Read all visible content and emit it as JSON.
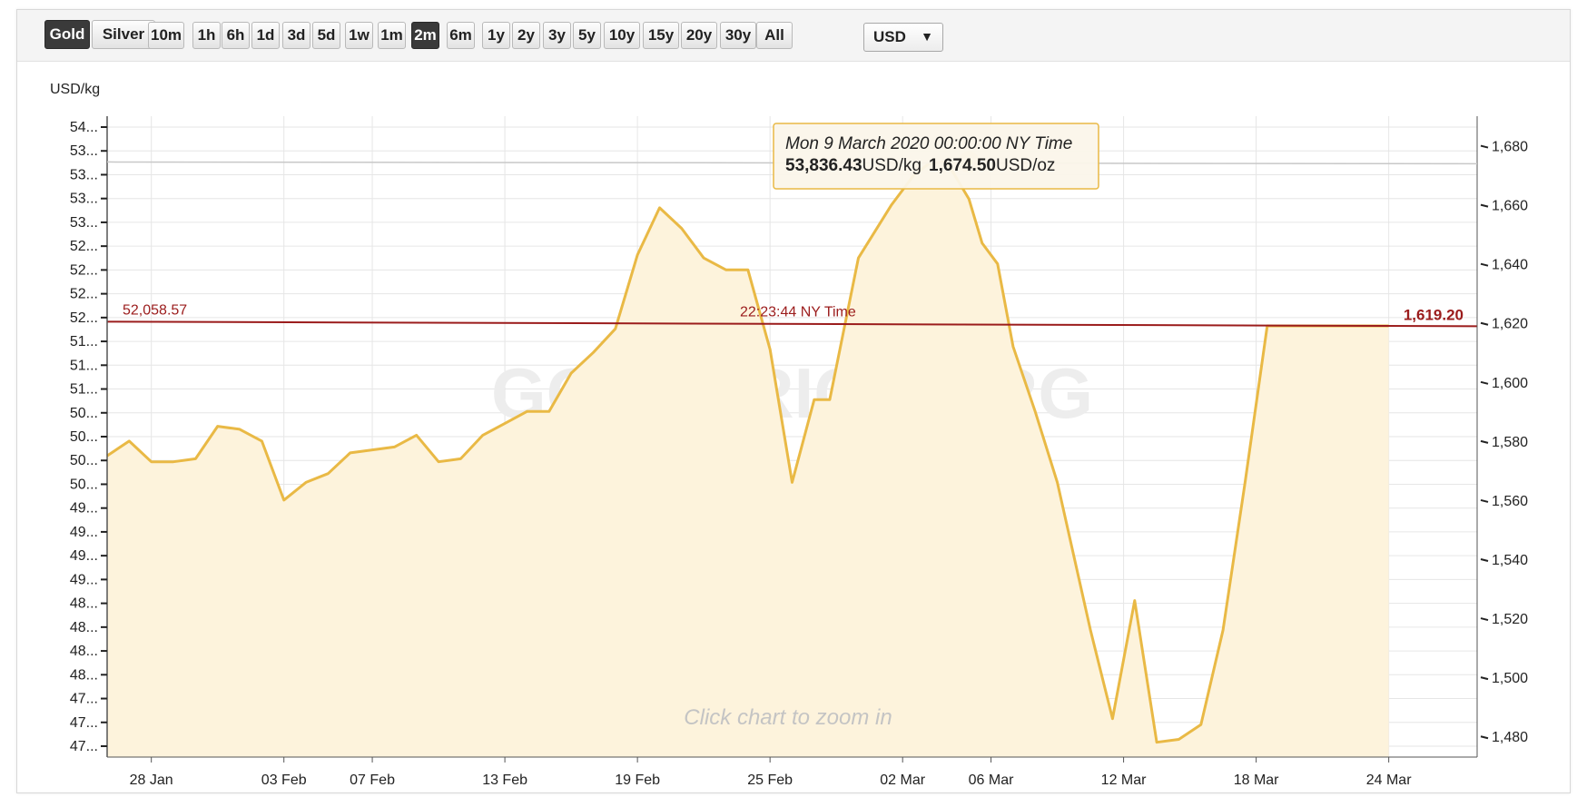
{
  "toolbar": {
    "metals": [
      {
        "label": "Gold",
        "active": true
      },
      {
        "label": "Silver",
        "active": false
      }
    ],
    "ranges": [
      {
        "label": "10m",
        "active": false
      },
      {
        "label": "1h",
        "active": false
      },
      {
        "label": "6h",
        "active": false
      },
      {
        "label": "1d",
        "active": false
      },
      {
        "label": "3d",
        "active": false
      },
      {
        "label": "5d",
        "active": false
      },
      {
        "label": "1w",
        "active": false
      },
      {
        "label": "1m",
        "active": false
      },
      {
        "label": "2m",
        "active": true
      },
      {
        "label": "6m",
        "active": false
      },
      {
        "label": "1y",
        "active": false
      },
      {
        "label": "2y",
        "active": false
      },
      {
        "label": "3y",
        "active": false
      },
      {
        "label": "5y",
        "active": false
      },
      {
        "label": "10y",
        "active": false
      },
      {
        "label": "15y",
        "active": false
      },
      {
        "label": "20y",
        "active": false
      },
      {
        "label": "30y",
        "active": false
      },
      {
        "label": "All",
        "active": false
      }
    ],
    "currency": {
      "value": "USD",
      "caret": "▼"
    }
  },
  "colors": {
    "line": "#e9b945",
    "area": "#fdf3dc",
    "reference": "#9b1c1c",
    "grid": "#e6e6e6",
    "axis": "#555555"
  },
  "chart_data": {
    "type": "area",
    "ylabel_left": "USD/kg",
    "left_ticks": [
      "47...",
      "47...",
      "47...",
      "48...",
      "48...",
      "48...",
      "48...",
      "49...",
      "49...",
      "49...",
      "49...",
      "50...",
      "50...",
      "50...",
      "50...",
      "51...",
      "51...",
      "51...",
      "52...",
      "52...",
      "52...",
      "52...",
      "53...",
      "53...",
      "53...",
      "53...",
      "54..."
    ],
    "right_ticks": [
      1480,
      1500,
      1520,
      1540,
      1560,
      1580,
      1600,
      1620,
      1640,
      1660,
      1680
    ],
    "right_ylim": [
      1473,
      1690
    ],
    "x_ticks": [
      "28 Jan",
      "03 Feb",
      "07 Feb",
      "13 Feb",
      "19 Feb",
      "25 Feb",
      "02 Mar",
      "06 Mar",
      "12 Mar",
      "18 Mar",
      "24 Mar"
    ],
    "x_tick_days": [
      2,
      8,
      12,
      18,
      24,
      30,
      36,
      40,
      46,
      52,
      58
    ],
    "x_range_days": [
      0,
      62
    ],
    "series": [
      {
        "unit": "USD/oz",
        "x_days": [
          0,
          1.0,
          2.0,
          3.0,
          4.0,
          5.0,
          6.0,
          7.0,
          8.0,
          9.0,
          10.0,
          11.0,
          12.0,
          13.0,
          14.0,
          15.0,
          16.0,
          17.0,
          18.0,
          19.0,
          20.0,
          21.0,
          22.0,
          23.0,
          24.0,
          25.0,
          26.0,
          27.0,
          28.0,
          29.0,
          30.0,
          31.0,
          32.0,
          32.7,
          34.0,
          35.5,
          36.5,
          37.2,
          38.0,
          39.0,
          39.6,
          40.3,
          41.0,
          42.0,
          43.0,
          44.5,
          45.5,
          46.5,
          47.5,
          48.5,
          49.5,
          50.5,
          51.5,
          52.5,
          53.4,
          54.0,
          55.0,
          55.7,
          56.4,
          58.0
        ],
        "values": [
          1575,
          1580,
          1573,
          1573,
          1574,
          1585,
          1584,
          1580,
          1560,
          1566,
          1569,
          1576,
          1577,
          1578,
          1582,
          1573,
          1574,
          1582,
          1586,
          1590,
          1590,
          1603,
          1610,
          1618,
          1643,
          1659,
          1652,
          1642,
          1638,
          1638,
          1611,
          1566,
          1594,
          1594,
          1642,
          1660,
          1670,
          1674,
          1674.5,
          1662,
          1647,
          1640,
          1612,
          1590,
          1566,
          1516,
          1486,
          1526,
          1478,
          1479,
          1484,
          1516,
          1566,
          1619,
          1619,
          1619,
          1619,
          1619,
          1619,
          1619
        ]
      }
    ],
    "reference_line": {
      "left_label": "52,058.57",
      "right_label": "1,619.20",
      "time_label": "22:23:44 NY Time",
      "value": 1619.2
    },
    "tooltip": {
      "title": "Mon 9 March 2020 00:00:00 NY Time",
      "kg_value": "53,836.43",
      "kg_unit": "USD/kg",
      "oz_value": "1,674.50",
      "oz_unit": "USD/oz",
      "x_day": 39.0,
      "value": 1674.5
    },
    "watermark": "GOLDPRICE.ORG",
    "hint": "Click chart to zoom in",
    "grid": true
  }
}
